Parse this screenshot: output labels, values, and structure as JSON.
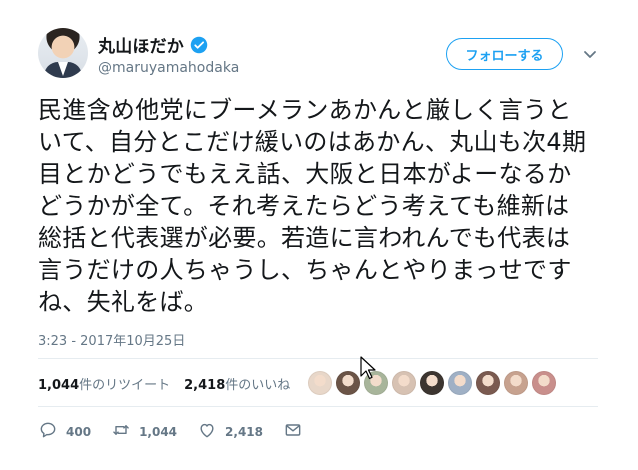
{
  "user": {
    "display_name": "丸山ほだか",
    "handle": "@maruyamahodaka",
    "verified": true
  },
  "header": {
    "follow_label": "フォローする",
    "menu_icon": "chevron-down-icon"
  },
  "tweet": {
    "text": "民進含め他党にブーメランあかんと厳しく言うといて、自分とこだけ緩いのはあかん、丸山も次4期目とかどうでもええ話、大阪と日本がよーなるかどうかが全て。それ考えたらどう考えても維新は総括と代表選が必要。若造に言われんでも代表は言うだけの人ちゃうし、ちゃんとやりまっせですね、失礼をば。",
    "timestamp": "3:23 - 2017年10月25日"
  },
  "stats": {
    "retweets_count": "1,044",
    "retweets_label": "件のリツイート",
    "likes_count": "2,418",
    "likes_label": "件のいいね"
  },
  "likers": [
    {
      "color": "#e8d7c9"
    },
    {
      "color": "#6b5447"
    },
    {
      "color": "#a8b59b"
    },
    {
      "color": "#d7c2b3"
    },
    {
      "color": "#3c3530"
    },
    {
      "color": "#9fb0c5"
    },
    {
      "color": "#7a5a50"
    },
    {
      "color": "#c7a28f"
    },
    {
      "color": "#c98f8c"
    }
  ],
  "actions": {
    "reply_count": "400",
    "retweet_count": "1,044",
    "like_count": "2,418"
  },
  "colors": {
    "accent": "#1da1f2",
    "muted": "#657786",
    "text": "#14171a"
  }
}
